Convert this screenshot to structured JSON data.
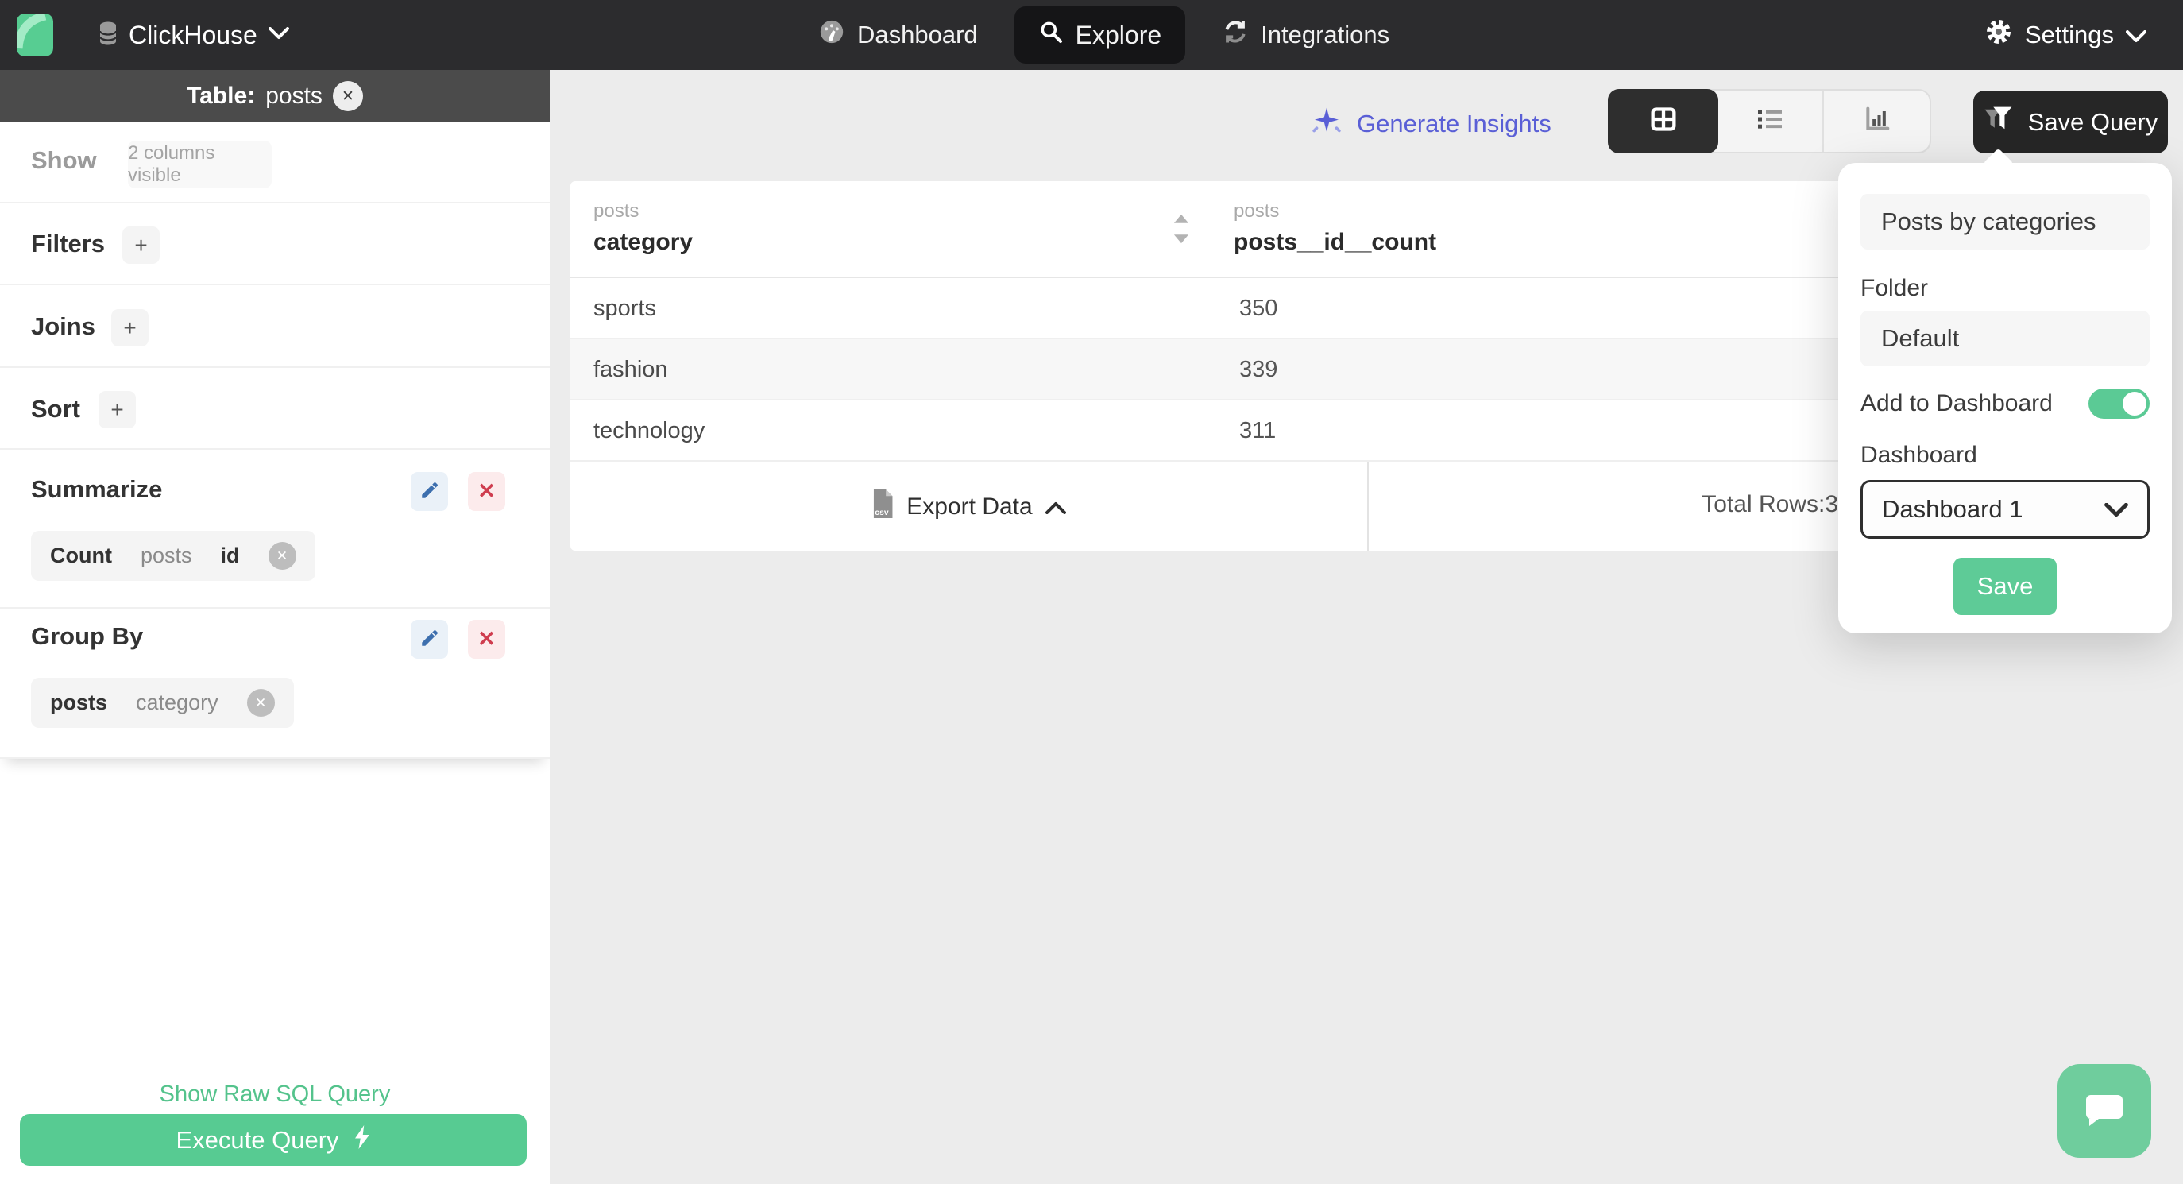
{
  "topnav": {
    "connection_label": "ClickHouse",
    "nav_dashboard": "Dashboard",
    "nav_explore": "Explore",
    "nav_integrations": "Integrations",
    "settings_label": "Settings"
  },
  "sidebar": {
    "table_label": "Table:",
    "table_name": "posts",
    "show_label": "Show",
    "columns_chip": "2 columns visible",
    "filters_label": "Filters",
    "joins_label": "Joins",
    "sort_label": "Sort",
    "add_label": "+",
    "summarize_label": "Summarize",
    "summarize_chip": {
      "agg": "Count",
      "table": "posts",
      "field": "id"
    },
    "groupby_label": "Group By",
    "groupby_chip": {
      "table": "posts",
      "field": "category"
    },
    "raw_sql_link": "Show Raw SQL Query",
    "execute_label": "Execute Query"
  },
  "main": {
    "generate_insights": "Generate Insights",
    "save_query_label": "Save Query"
  },
  "table": {
    "col1_group": "posts",
    "col1_field": "category",
    "col2_group": "posts",
    "col2_field": "posts__id__count",
    "rows": [
      {
        "category": "sports",
        "count": "350"
      },
      {
        "category": "fashion",
        "count": "339"
      },
      {
        "category": "technology",
        "count": "311"
      }
    ],
    "export_label": "Export Data",
    "total_rows_label": "Total Rows:",
    "total_rows_value": "3"
  },
  "popover": {
    "name_value": "Posts by categories",
    "folder_label": "Folder",
    "folder_value": "Default",
    "add_to_dashboard_label": "Add to Dashboard",
    "toggle_state": "on",
    "dashboard_label": "Dashboard",
    "dashboard_value": "Dashboard 1",
    "save_label": "Save"
  },
  "icons": {
    "x": "✕",
    "close": "✕"
  },
  "colors": {
    "brand_green": "#57cb92",
    "indigo_accent": "#5a5fd6",
    "topnav_dark": "#2c2c2e",
    "sidebar_header_gray": "#4b4b4b",
    "danger_red": "#cf3d4f",
    "edit_blue": "#3d6fae"
  }
}
